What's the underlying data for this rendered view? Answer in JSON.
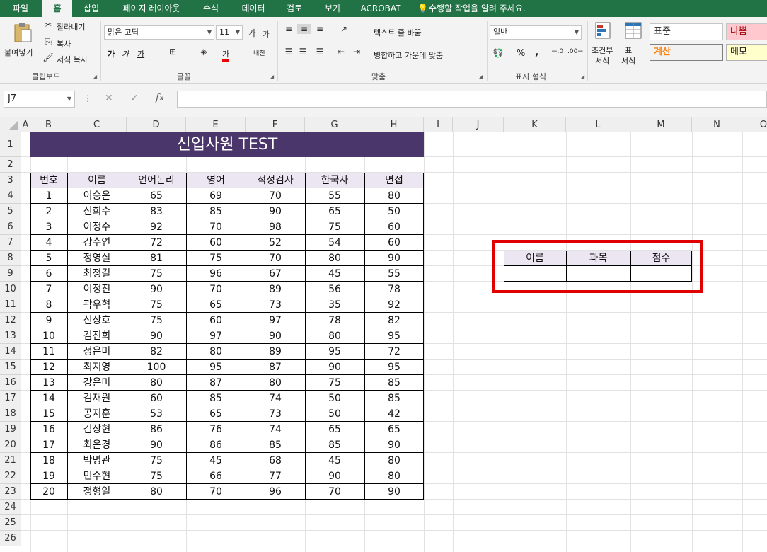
{
  "tabs": [
    "파일",
    "홈",
    "삽입",
    "페이지 레이아웃",
    "수식",
    "데이터",
    "검토",
    "보기",
    "ACROBAT"
  ],
  "tell_me": "수행할 작업을 알려 주세요.",
  "ribbon": {
    "clipboard": {
      "paste": "붙여넣기",
      "cut": "잘라내기",
      "copy": "복사",
      "format_painter": "서식 복사",
      "label": "클립보드"
    },
    "font": {
      "name": "맑은 고딕",
      "size": "11",
      "bold": "가",
      "italic": "가",
      "underline": "가",
      "fontcolor": "가",
      "phonetic": "내천",
      "label": "글꼴"
    },
    "alignment": {
      "wrap": "텍스트 줄 바꿈",
      "merge": "병합하고 가운데 맞춤",
      "label": "맞춤"
    },
    "number": {
      "format": "일반",
      "percent": "%",
      "comma": ",",
      "label": "표시 형식"
    },
    "styles": {
      "conditional": "조건부\n서식",
      "table": "표\n서식",
      "normal": "표준",
      "bad": "나쁨",
      "calc": "계산",
      "note": "메모"
    },
    "colors": {
      "brand": "#217346",
      "bad_bg": "#ffc7ce",
      "bad_fg": "#9c0006",
      "calc_fg": "#fa7d00",
      "note_bg": "#ffffcc"
    }
  },
  "formula_bar": {
    "name_box": "J7",
    "cancel": "✕",
    "enter": "✓",
    "fx": "fx",
    "value": ""
  },
  "columns": [
    "A",
    "B",
    "C",
    "D",
    "E",
    "F",
    "G",
    "H",
    "I",
    "J",
    "K",
    "L",
    "M",
    "N",
    "O"
  ],
  "rows": [
    "1",
    "2",
    "3",
    "4",
    "5",
    "6",
    "7",
    "8",
    "9",
    "10",
    "11",
    "12",
    "13",
    "14",
    "15",
    "16",
    "17",
    "18",
    "19",
    "20",
    "21",
    "22",
    "23",
    "24",
    "25",
    "26"
  ],
  "sheet": {
    "title": "신입사원 TEST",
    "headers": [
      "번호",
      "이름",
      "언어논리",
      "영어",
      "적성검사",
      "한국사",
      "면접"
    ],
    "records": [
      [
        "1",
        "이승은",
        "65",
        "69",
        "70",
        "55",
        "80"
      ],
      [
        "2",
        "신희수",
        "83",
        "85",
        "90",
        "65",
        "50"
      ],
      [
        "3",
        "이정수",
        "92",
        "70",
        "98",
        "75",
        "60"
      ],
      [
        "4",
        "강수연",
        "72",
        "60",
        "52",
        "54",
        "60"
      ],
      [
        "5",
        "정영실",
        "81",
        "75",
        "70",
        "80",
        "90"
      ],
      [
        "6",
        "최정길",
        "75",
        "96",
        "67",
        "45",
        "55"
      ],
      [
        "7",
        "이정진",
        "90",
        "70",
        "89",
        "56",
        "78"
      ],
      [
        "8",
        "곽우혁",
        "75",
        "65",
        "73",
        "35",
        "92"
      ],
      [
        "9",
        "신상호",
        "75",
        "60",
        "97",
        "78",
        "82"
      ],
      [
        "10",
        "김진희",
        "90",
        "97",
        "90",
        "80",
        "95"
      ],
      [
        "11",
        "정은미",
        "82",
        "80",
        "89",
        "95",
        "72"
      ],
      [
        "12",
        "최지영",
        "100",
        "95",
        "87",
        "90",
        "95"
      ],
      [
        "13",
        "강은미",
        "80",
        "87",
        "80",
        "75",
        "85"
      ],
      [
        "14",
        "김재원",
        "60",
        "85",
        "74",
        "50",
        "85"
      ],
      [
        "15",
        "공지훈",
        "53",
        "65",
        "73",
        "50",
        "42"
      ],
      [
        "16",
        "김상현",
        "86",
        "76",
        "74",
        "65",
        "65"
      ],
      [
        "17",
        "최은경",
        "90",
        "86",
        "85",
        "85",
        "90"
      ],
      [
        "18",
        "박명관",
        "75",
        "45",
        "68",
        "45",
        "80"
      ],
      [
        "19",
        "민수현",
        "75",
        "66",
        "77",
        "90",
        "80"
      ],
      [
        "20",
        "정형일",
        "80",
        "70",
        "96",
        "70",
        "90"
      ]
    ],
    "lookup_headers": [
      "이름",
      "과목",
      "점수"
    ],
    "lookup_values": [
      "",
      "",
      ""
    ]
  },
  "theme": {
    "title_bg": "#4b366b",
    "header_bg": "#ebe6f2",
    "highlight": "#e00000"
  }
}
